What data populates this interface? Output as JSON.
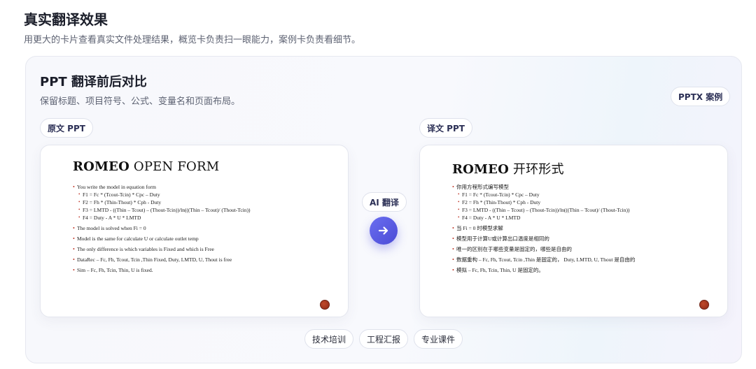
{
  "section": {
    "title": "真实翻译效果",
    "subtitle": "用更大的卡片查看真实文件处理结果，概览卡负责扫一眼能力，案例卡负责看细节。"
  },
  "panel": {
    "title": "PPT 翻译前后对比",
    "subtitle": "保留标题、项目符号、公式、变量名和页面布局。",
    "badge": "PPTX 案例",
    "source_label": "原文 PPT",
    "target_label": "译文 PPT",
    "ai_label": "AI 翻译",
    "arrow_icon": "arrow-right-icon",
    "accent_color": "#5a5ce6",
    "tags": [
      "技术培训",
      "工程汇报",
      "专业课件"
    ]
  },
  "source_slide": {
    "heading_a": "ROMEO",
    "heading_b": " OPEN FORM",
    "b1": "You write the model in equation form",
    "s1": "F1 = Fc * (Tcout-Tcin) * Cpc – Duty",
    "s2": "F2 = Fh * (Thin-Thout) * Cph - Duty",
    "s3": "F3 = LMTD - ((Thin – Tcout) – (Thout-Tcin))/ln(((Thin – Tcout)/ (Thout-Tcin))",
    "s4": "F4 = Duty - A * U * LMTD",
    "b2": "The model is solved when Fi = 0",
    "b3": "Model is the same for calculate U or calculate outlet temp",
    "b4": "The only difference is which variables is Fixed and which is Free",
    "b5": "DataRec – Fc, Fh, Tcout, Tcin ,Thin Fixed, Duty, LMTD, U, Thout is free",
    "b6": "Sim – Fc, Fh, Tcin, Thin, U is fixed."
  },
  "target_slide": {
    "heading_a": "ROMEO",
    "heading_b": " 开环形式",
    "b1": "你用方程形式编写模型",
    "s1": "F1 = Fc * (Tcout-Tcin) * Cpc – Duty",
    "s2": "F2 = Fh * (Thin-Thout) * Cph - Duty",
    "s3": "F3 = LMTD - ((Thin – Tcout) – (Thout-Tcin))/ln(((Thin – Tcout)/ (Thout-Tcin))",
    "s4": "F4 = Duty - A * U * LMTD",
    "b2": "当 Fi = 0 时模型求解",
    "b3": "模型用于计算U或计算出口温度是相同的",
    "b4": "唯一的区别在于哪些变量是固定的，哪些是自由的",
    "b5": "数据重构 – Fc, Fh, Tcout, Tcin ,Thin 是固定的， Duty, LMTD, U, Thout 是自由的",
    "b6": "模拟 – Fc, Fh, Tcin, Thin, U 是固定的。"
  }
}
